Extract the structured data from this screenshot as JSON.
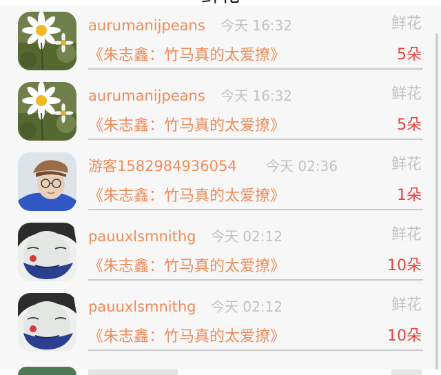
{
  "header": {
    "title": "鲜花"
  },
  "items": [
    {
      "username": "aurumanijpeans",
      "time": "今天 16:32",
      "gift_type": "鲜花",
      "book": "《朱志鑫：竹马真的太爱撩》",
      "count": "5朵",
      "avatar": "daisy"
    },
    {
      "username": "aurumanijpeans",
      "time": "今天 16:32",
      "gift_type": "鲜花",
      "book": "《朱志鑫：竹马真的太爱撩》",
      "count": "5朵",
      "avatar": "daisy"
    },
    {
      "username": "游客1582984936054",
      "time": "今天 02:36",
      "gift_type": "鲜花",
      "book": "《朱志鑫：竹马真的太爱撩》",
      "count": "1朵",
      "avatar": "boy-with-beret"
    },
    {
      "username": "pauuxlsmnithg",
      "time": "今天 02:12",
      "gift_type": "鲜花",
      "book": "《朱志鑫：竹马真的太爱撩》",
      "count": "10朵",
      "avatar": "clown-face"
    },
    {
      "username": "pauuxlsmnithg",
      "time": "今天 02:12",
      "gift_type": "鲜花",
      "book": "《朱志鑫：竹马真的太爱撩》",
      "count": "10朵",
      "avatar": "clown-face"
    }
  ],
  "colors": {
    "accent": "#ee8c5a",
    "count": "#e8403e",
    "muted": "#c2c2c2",
    "background": "#f7f7f7"
  }
}
